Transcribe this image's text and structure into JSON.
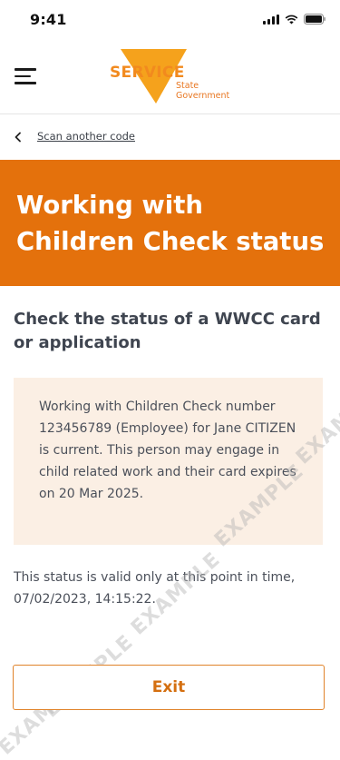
{
  "status_bar": {
    "time": "9:41"
  },
  "header": {
    "logo_word": "SERVICE",
    "logo_sub_line1": "State",
    "logo_sub_line2": "Government",
    "brand_color": "#f28a1e"
  },
  "back_link": {
    "label": "Scan another code"
  },
  "banner": {
    "title": "Working with Children Check status",
    "color": "#e4710c"
  },
  "section": {
    "heading": "Check the status of a WWCC card or application"
  },
  "result": {
    "message": "Working with Children Check number 123456789 (Employee) for Jane CITIZEN is current. This person may engage in child related work and their card expires on 20 Mar 2025."
  },
  "validity": {
    "text": "This status is valid only at this point in time, 07/02/2023, 14:15:22."
  },
  "exit_button": {
    "label": "Exit"
  },
  "watermark": {
    "text": "EXAMPLE"
  },
  "icons": [
    "menu-icon",
    "chevron-left-icon",
    "signal-icon",
    "wifi-icon",
    "battery-icon"
  ]
}
